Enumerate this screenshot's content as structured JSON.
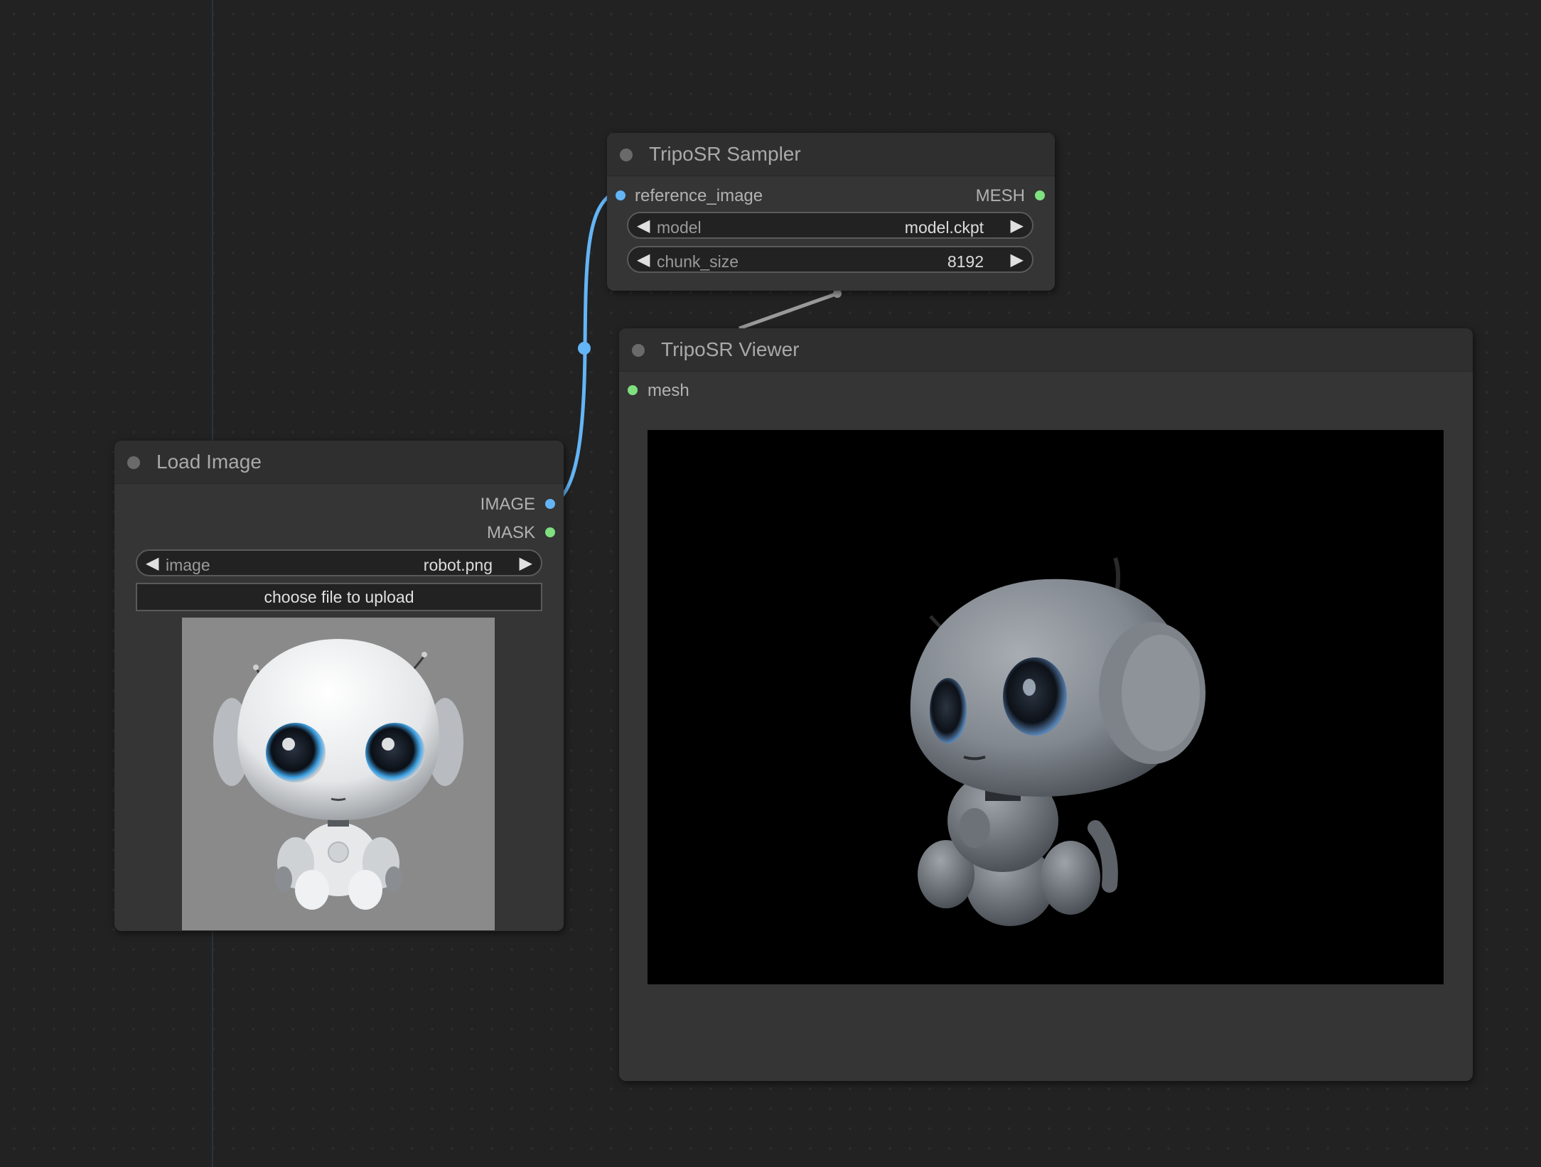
{
  "colors": {
    "canvas_bg": "#222222",
    "node_bg": "#353535",
    "image_link": "#64b5f6",
    "mesh_socket": "#7fe07f",
    "mesh_link": "#9a9a9a"
  },
  "load_image": {
    "title": "Load Image",
    "outputs": {
      "image": "IMAGE",
      "mask": "MASK"
    },
    "widget": {
      "label": "image",
      "value": "robot.png"
    },
    "upload_label": "choose file to upload",
    "preview_icon": "robot-preview-image"
  },
  "sampler": {
    "title": "TripoSR Sampler",
    "input": "reference_image",
    "output": "MESH",
    "widgets": [
      {
        "label": "model",
        "value": "model.ckpt"
      },
      {
        "label": "chunk_size",
        "value": "8192"
      }
    ]
  },
  "viewer": {
    "title": "TripoSR Viewer",
    "input": "mesh",
    "canvas_icon": "robot-3d-mesh-render"
  }
}
